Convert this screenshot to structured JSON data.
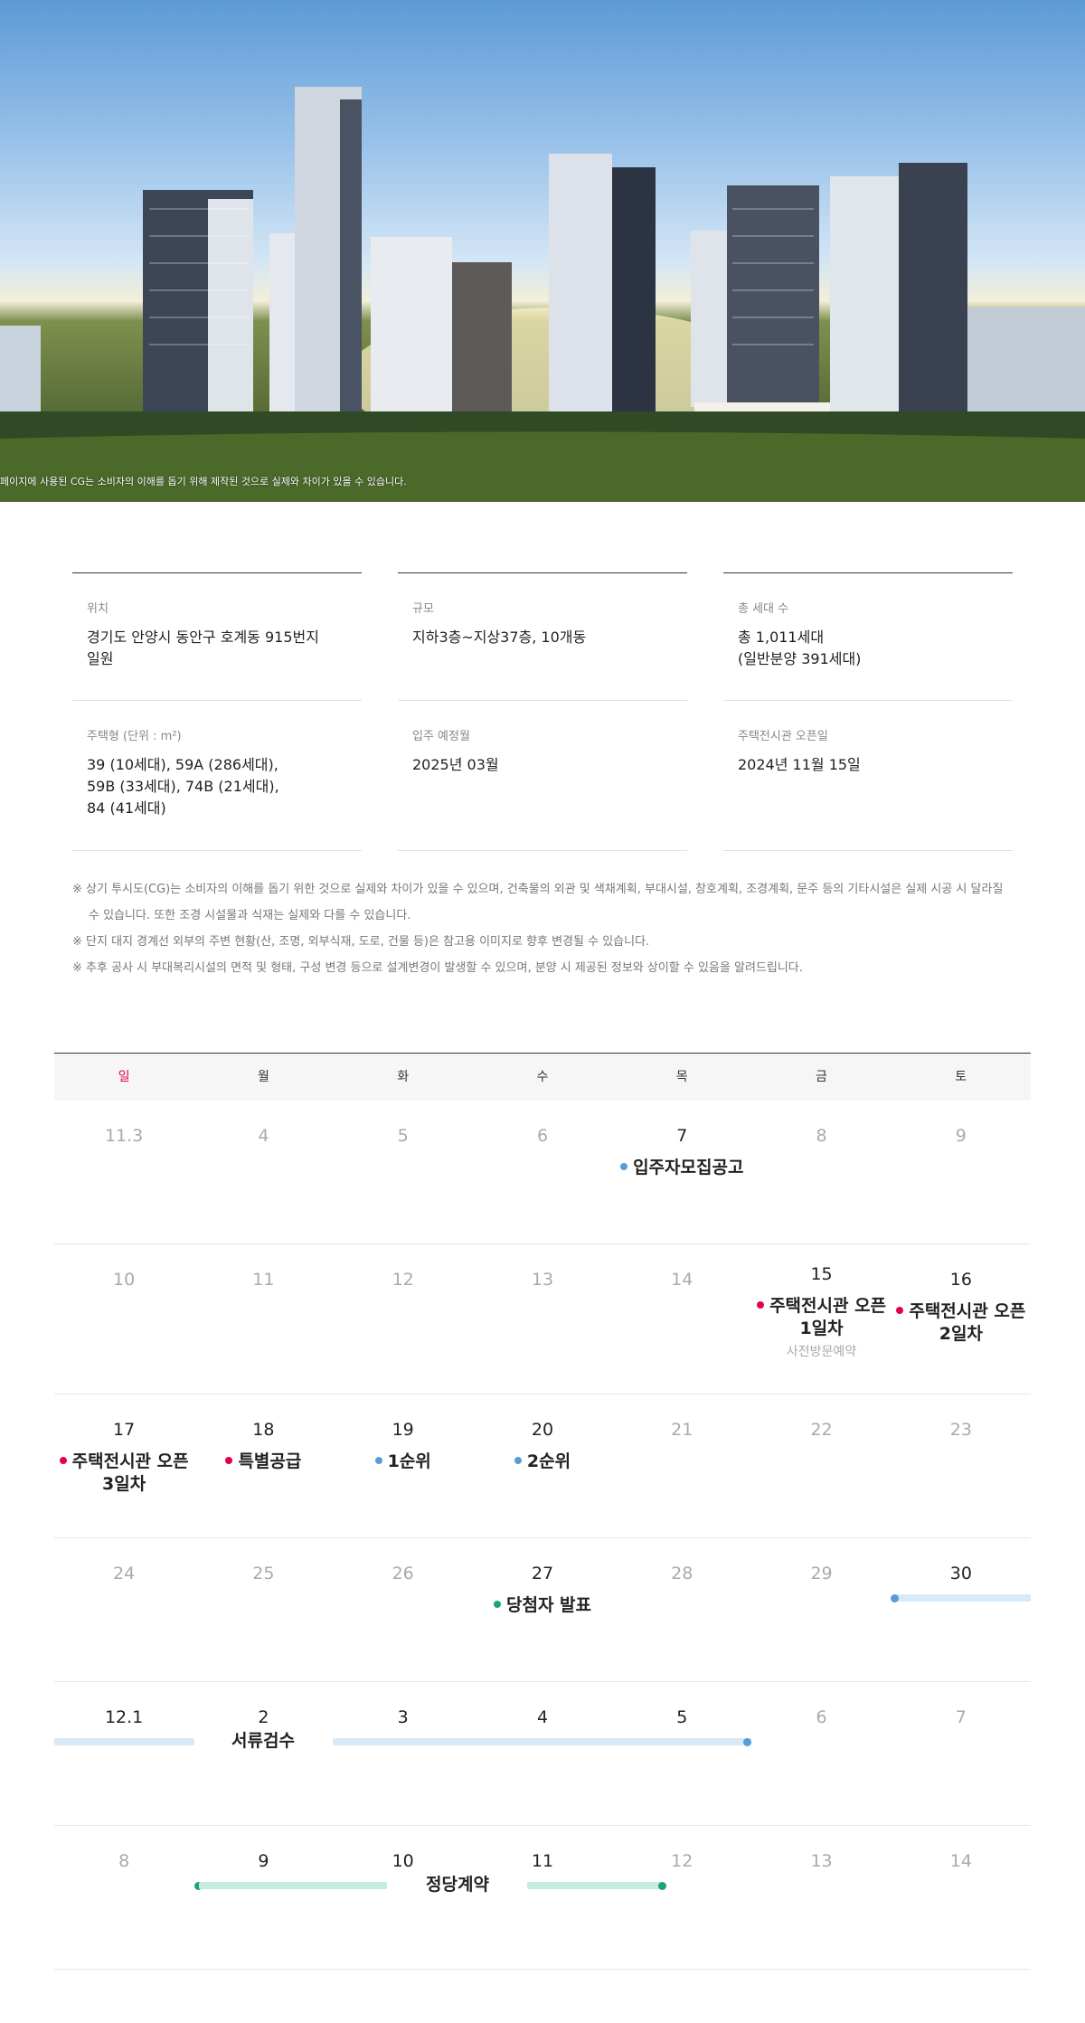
{
  "hero": {
    "caption": "페이지에 사용된 CG는 소비자의 이해를 돕기 위해 제작된 것으로 실제와 차이가 있을 수 있습니다."
  },
  "info": {
    "items": [
      {
        "label": "위치",
        "value": "경기도 안양시 동안구 호계동 915번지\n일원"
      },
      {
        "label": "규모",
        "value": "지하3층~지상37층, 10개동"
      },
      {
        "label": "총 세대 수",
        "value": "총 1,011세대\n(일반분양 391세대)"
      },
      {
        "label": "주택형 (단위 : m²)",
        "value": "39 (10세대), 59A (286세대),\n59B (33세대), 74B (21세대),\n84 (41세대)"
      },
      {
        "label": "입주 예정월",
        "value": "2025년 03월"
      },
      {
        "label": "주택전시관 오픈일",
        "value": "2024년 11월 15일"
      }
    ]
  },
  "notes": [
    "※ 상기 투시도(CG)는 소비자의 이해를 돕기 위한 것으로 실제와 차이가 있을 수 있으며, 건축물의 외관 및 색채계획, 부대시설, 창호계획, 조경계획, 문주 등의 기타시설은 실제 시공 시 달라질 수 있습니다. 또한 조경 시설물과 식재는 실제와 다를 수 있습니다.",
    "※ 단지 대지 경계선 외부의 주변 현황(산, 조명, 외부식재, 도로, 건물 등)은 참고용 이미지로 향후 변경될 수 있습니다.",
    "※ 추후 공사 시 부대복리시설의 면적 및 형태, 구성 변경 등으로 설계변경이 발생할 수 있으며, 분양 시 제공된 정보와 상이할 수 있음을 알려드립니다."
  ],
  "calendar": {
    "weekdays": [
      "일",
      "월",
      "화",
      "수",
      "목",
      "금",
      "토"
    ],
    "weeks": [
      {
        "days": [
          "11.3",
          "4",
          "5",
          "6",
          "7",
          "8",
          "9"
        ]
      },
      {
        "days": [
          "10",
          "11",
          "12",
          "13",
          "14",
          "15",
          "16"
        ]
      },
      {
        "days": [
          "17",
          "18",
          "19",
          "20",
          "21",
          "22",
          "23"
        ]
      },
      {
        "days": [
          "24",
          "25",
          "26",
          "27",
          "28",
          "29",
          "30"
        ]
      },
      {
        "days": [
          "12.1",
          "2",
          "3",
          "4",
          "5",
          "6",
          "7"
        ]
      },
      {
        "days": [
          "8",
          "9",
          "10",
          "11",
          "12",
          "13",
          "14"
        ]
      }
    ],
    "events": {
      "nov7": "입주자모집공고",
      "nov15": "주택전시관 오픈\n1일차",
      "nov15_sub": "사전방문예약",
      "nov16": "주택전시관 오픈\n2일차",
      "nov17": "주택전시관 오픈\n3일차",
      "nov18": "특별공급",
      "nov19": "1순위",
      "nov20": "2순위",
      "nov27": "당첨자 발표",
      "docs": "서류검수",
      "contract": "정당계약"
    },
    "colors": {
      "red": "#e4004f",
      "blue": "#5a9bd5",
      "green": "#1aa47a"
    }
  }
}
